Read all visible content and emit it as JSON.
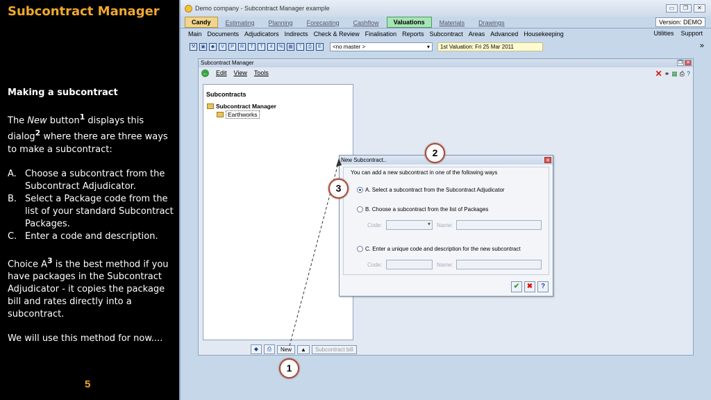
{
  "slide": {
    "title": "Subcontract Manager",
    "heading": "Making a subcontract",
    "para1_a": "The ",
    "para1_new": "New",
    "para1_b": " button",
    "para1_sup1": "1",
    "para1_c": " displays this dialog",
    "para1_sup2": "2",
    "para1_d": " where there are three ways to make a subcontract:",
    "list": [
      {
        "mark": "A.",
        "text": "Choose a subcontract from the Subcontract Adjudicator."
      },
      {
        "mark": "B.",
        "text": "Select a Package code from the list of your standard Subcontract Packages."
      },
      {
        "mark": "C.",
        "text": "Enter a code and description."
      }
    ],
    "para2_a": "Choice A",
    "para2_sup": "3",
    "para2_b": " is the best method if you have packages in the Subcontract Adjudicator - it copies the package bill and rates directly into a subcontract.",
    "para3": "We will use this method for now....",
    "page_number": "5"
  },
  "app": {
    "window_title": "Demo company - Subcontract Manager example",
    "tabs": [
      "Candy",
      "Estimating",
      "Planning",
      "Forecasting",
      "Cashflow",
      "Valuations",
      "Materials",
      "Drawings"
    ],
    "version": "Version: DEMO",
    "menu": [
      "Main",
      "Documents",
      "Adjudicators",
      "Indirects",
      "Check & Review",
      "Finalisation",
      "Reports",
      "Subcontract",
      "Areas",
      "Advanced",
      "Housekeeping"
    ],
    "menu_right": [
      "Utilities",
      "Support"
    ],
    "master_select": "<no master >",
    "valuation_field": "1st Valuation: Fri 25 Mar 2011",
    "inner_title": "Subcontract Manager",
    "inner_menu": [
      "Edit",
      "View",
      "Tools"
    ],
    "tree_heading": "Subcontracts",
    "tree_root": "Subcontract Manager",
    "tree_child": "Earthworks",
    "new_button": "New",
    "subcontract_bill_button": "Subcontract bill"
  },
  "dialog": {
    "title": "New Subcontract..",
    "intro": "You can add a new subcontract in one of the following ways",
    "option_a": "A.  Select a subcontract from the Subcontract Adjudicator",
    "option_b": "B.  Choose a subcontract from the list of Packages",
    "option_c": "C.  Enter a unique code and description for the new subcontract",
    "code_label": "Code:",
    "name_label": "Name:"
  },
  "callouts": [
    "1",
    "2",
    "3"
  ]
}
